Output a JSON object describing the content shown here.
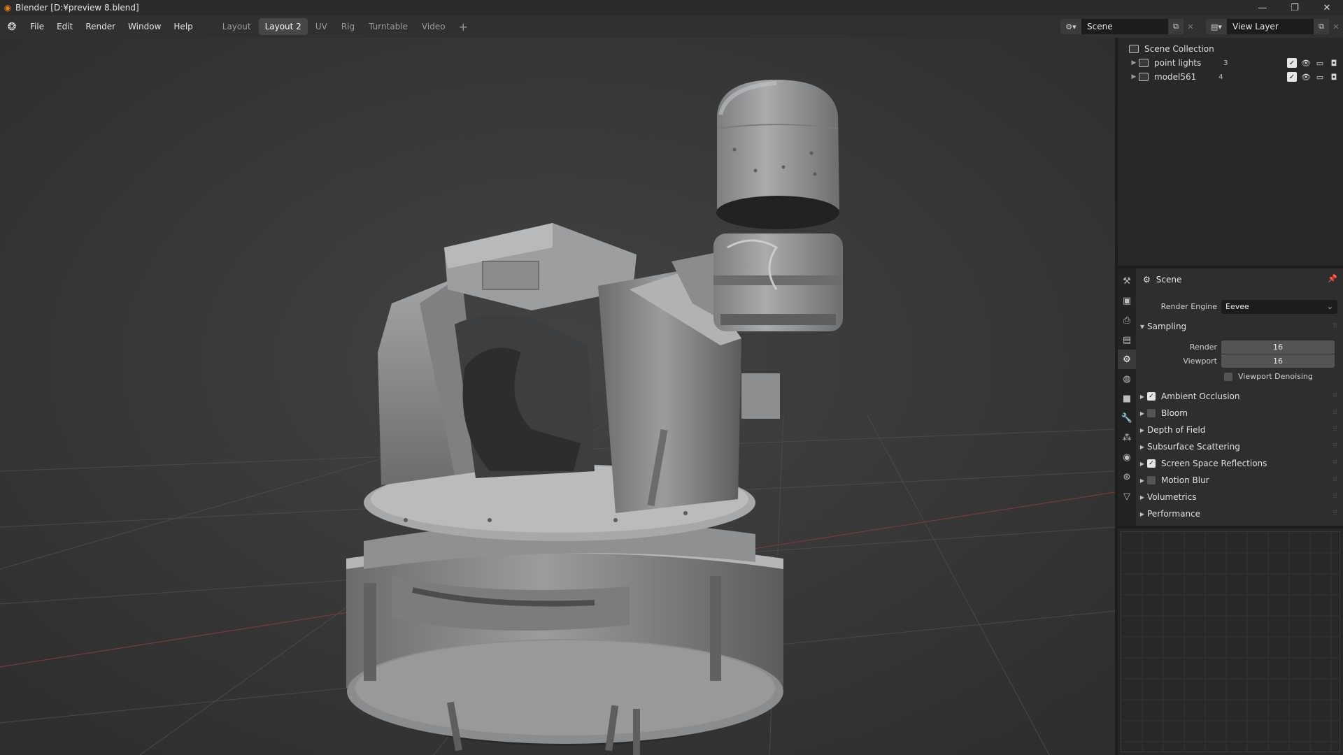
{
  "window": {
    "title": "Blender [D:¥preview 8.blend]",
    "minimize": "—",
    "restore": "❐",
    "close": "✕"
  },
  "menu": [
    "File",
    "Edit",
    "Render",
    "Window",
    "Help"
  ],
  "workspaces": {
    "tabs": [
      "Layout",
      "Layout 2",
      "UV",
      "Rig",
      "Turntable",
      "Video"
    ],
    "active": "Layout 2",
    "add": "+"
  },
  "scene_selector": {
    "value": "Scene"
  },
  "view_layer_selector": {
    "value": "View Layer"
  },
  "outliner": {
    "root": "Scene Collection",
    "items": [
      {
        "label": "point lights",
        "badge": "3"
      },
      {
        "label": "model561",
        "badge": "4"
      }
    ]
  },
  "properties": {
    "header": "Scene",
    "render_engine_label": "Render Engine",
    "render_engine_value": "Eevee",
    "sampling": {
      "title": "Sampling",
      "render_label": "Render",
      "render_value": "16",
      "viewport_label": "Viewport",
      "viewport_value": "16",
      "denoising_label": "Viewport Denoising"
    },
    "panels": [
      {
        "label": "Ambient Occlusion",
        "checkbox": true,
        "checked": true
      },
      {
        "label": "Bloom",
        "checkbox": true,
        "checked": false
      },
      {
        "label": "Depth of Field",
        "checkbox": false
      },
      {
        "label": "Subsurface Scattering",
        "checkbox": false
      },
      {
        "label": "Screen Space Reflections",
        "checkbox": true,
        "checked": true
      },
      {
        "label": "Motion Blur",
        "checkbox": true,
        "checked": false
      },
      {
        "label": "Volumetrics",
        "checkbox": false
      },
      {
        "label": "Performance",
        "checkbox": false
      }
    ]
  },
  "colors": {
    "accent_orange": "#e87d0d",
    "viewport_bg": "#3d3d3d",
    "panel_bg": "#2e2e2e"
  }
}
